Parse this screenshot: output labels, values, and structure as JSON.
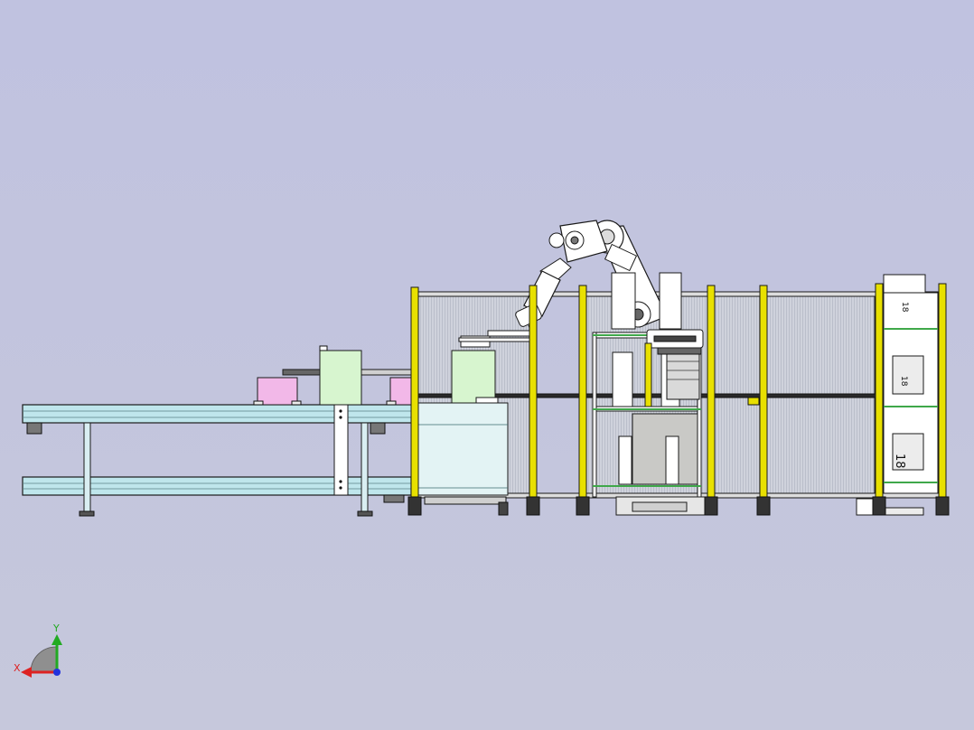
{
  "viewport": {
    "background": "#c2c4de"
  },
  "triad": {
    "y_label": "Y",
    "x_label": "X",
    "y_color": "#22aa22",
    "x_color": "#dd2222",
    "z_color": "#2233dd"
  },
  "cell_labels": {
    "rack_label_1": "18",
    "rack_label_2": "18",
    "rack_label_3": "18"
  },
  "colors": {
    "safety_post": "#e8e000",
    "conveyor": "#bfe6ec",
    "carton_pink": "#f2b8e8",
    "carton_green": "#d7f5cf",
    "frame": "#1a1a1a",
    "robot": "#ffffff",
    "shelf_green": "#3fa84a",
    "fence_mesh": "#9aa0ad"
  }
}
